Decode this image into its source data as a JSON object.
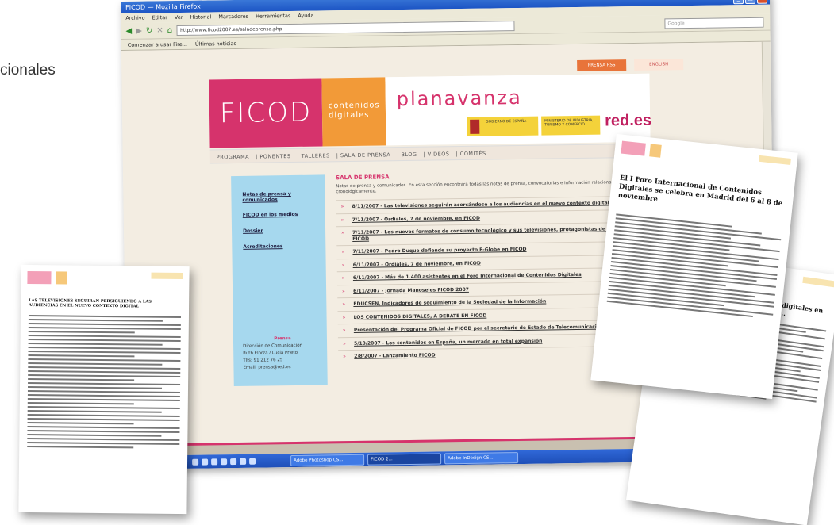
{
  "caption": {
    "text": "cionales"
  },
  "browser": {
    "title": "FICOD — Mozilla Firefox",
    "menu": [
      "Archivo",
      "Editar",
      "Ver",
      "Historial",
      "Marcadores",
      "Herramientas",
      "Ayuda"
    ],
    "address": "http://www.ficod2007.es/saladeprensa.php",
    "search_placeholder": "Google",
    "bookmarks": [
      "Comenzar a usar Fire...",
      "Últimas noticias"
    ],
    "taskbar_tasks": [
      "Adobe Photoshop CS...",
      "FICOD 2...",
      "Adobe InDesign CS..."
    ]
  },
  "site": {
    "top_buttons": [
      "PRENSA RSS",
      "ENGLISH"
    ],
    "logo": "FICOD",
    "tagline_lines": [
      "contenidos",
      "digitales"
    ],
    "plan": "planavanza",
    "gob_label": "GOBIERNO DE ESPAÑA",
    "ministerio_label": "MINISTERIO DE INDUSTRIA, TURISMO Y COMERCIO",
    "rede": "red.es",
    "nav": [
      "PROGRAMA",
      "PONENTES",
      "TALLERES",
      "SALA DE PRENSA",
      "BLOG",
      "VIDEOS",
      "COMITÉS"
    ],
    "sidebar_links": [
      "Notas de prensa y comunicados",
      "FICOD en los medios",
      "Dossier",
      "Acreditaciones"
    ],
    "contact_heading": "Prensa",
    "contact_lines": [
      "Dirección de Comunicación",
      "Ruth Elorza / Lucía Prieto",
      "Tlfs: 91 212 76 25",
      "Email: prensa@red.es"
    ],
    "section_title": "SALA DE PRENSA",
    "intro": "Notas de prensa y comunicados. En esta sección encontrará todas las notas de prensa, convocatorias e información relacionada, ordenadas cronológicamente.",
    "news": [
      "8/11/2007 - Las televisiones seguirán acercándose a los audiencias en el nuevo contexto digital",
      "7/11/2007 - Ordiales, 7 de noviembre, en FICOD",
      "7/11/2007 - Los nuevos formatos de consumo tecnológico y sus televisiones, protagonistas de la sesión de FICOD",
      "7/11/2007 - Pedro Duque defiende su proyecto E-Globe en FICOD",
      "6/11/2007 - Ordiales, 7 de noviembre, en FICOD",
      "6/11/2007 - Más de 1.400 asistentes en el Foro Internacional de Contenidos Digitales",
      "6/11/2007 - Jornada Manoseles FICOD 2007",
      "EDUCSEN, Indicadores de seguimiento de la Sociedad de la Información",
      "LOS CONTENIDOS DIGITALES, A DEBATE EN FICOD",
      "Presentación del Programa Oficial de FICOD por el secretario de Estado de Telecomunicaciones",
      "5/10/2007 - Los contenidos en España, un mercado en total expansión",
      "2/8/2007 - Lanzamiento FICOD"
    ]
  },
  "papers": {
    "left_title": "LAS TELEVISIONES SEGUIRÁN PERSIGUIENDO A LAS AUDIENCIAS EN EL NUEVO CONTEXTO DIGITAL",
    "middle_title": "El I Foro Internacional de Contenidos Digitales se celebra en Madrid del 6 al 8 de noviembre",
    "right_title": "Los contenidos digitales en la industria de ..."
  }
}
